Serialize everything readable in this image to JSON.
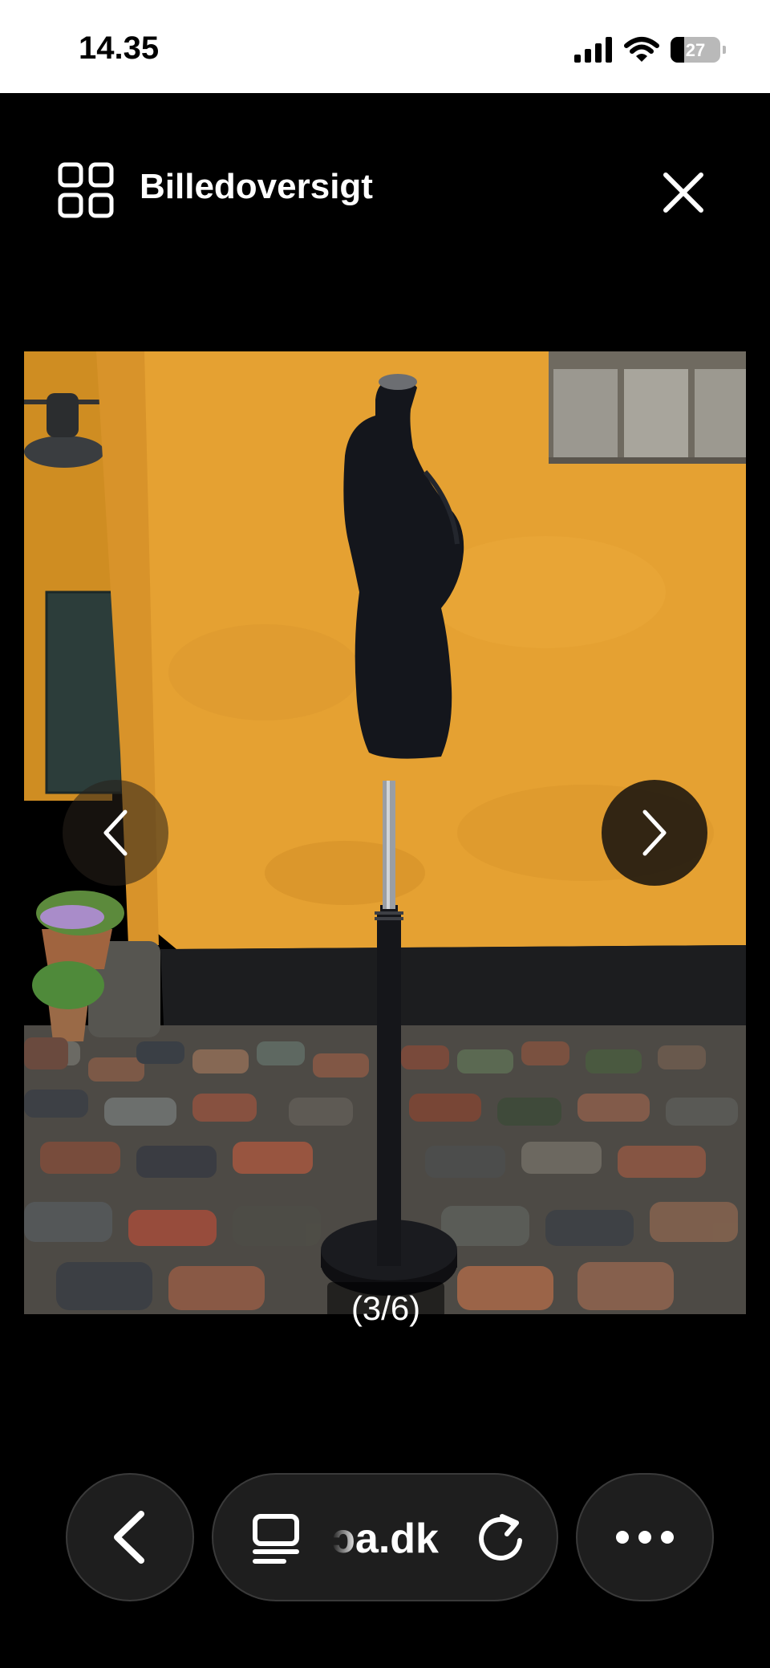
{
  "status_bar": {
    "time": "14.35",
    "battery": "27",
    "battery_level": 0.27
  },
  "header": {
    "title": "Billedoversigt",
    "grid_icon": "grid-icon",
    "close_icon": "close-icon"
  },
  "gallery": {
    "counter": "(3/6)",
    "prev_icon": "chevron-left-icon",
    "next_icon": "chevron-right-icon",
    "photo_subject": "dress-form-mannequin-photo"
  },
  "browser_bar": {
    "url": "ɔa.dk",
    "back_icon": "back-arrow-icon",
    "reader_icon": "reader-mode-icon",
    "reload_icon": "reload-icon",
    "more_icon": "more-icon"
  },
  "colors": {
    "background": "#000000",
    "wall": "#e5a132",
    "mannequin": "#14161c",
    "pill": "#1e1e1e"
  }
}
